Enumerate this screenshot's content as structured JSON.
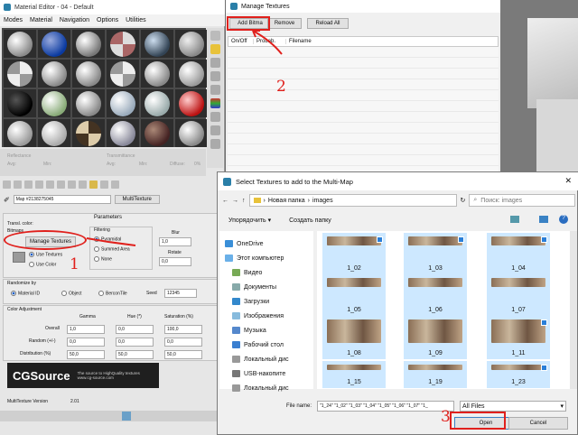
{
  "material_editor": {
    "title": "Material Editor - 04 - Default",
    "menu": [
      "Modes",
      "Material",
      "Navigation",
      "Options",
      "Utilities"
    ],
    "reflectance_label": "Reflectance",
    "transmittance_label": "Transmittance",
    "avg_label": "Avg:",
    "min_label": "Min:",
    "diffuse_label": "Diffuse:",
    "diffuse_value": "0%",
    "map_name": "Map #2138275045",
    "map_type": "MultiTexture",
    "parameters_title": "Parameters",
    "transl_color_label": "Transl. color:",
    "bitmaps_label": "Bitmaps",
    "manage_textures_btn": "Manage Textures",
    "filtering_label": "Filtering",
    "filter_options": [
      "Pyramidal",
      "Summed Area",
      "None"
    ],
    "blur_label": "Blur",
    "blur_value": "1,0",
    "rotate_label": "Rotate",
    "rotate_value": "0,0",
    "use_textures": "Use Textures",
    "use_color": "Use Color",
    "randomize_label": "Randomize by",
    "randomize_options": [
      "Material ID",
      "Object",
      "BerconTile"
    ],
    "seed_label": "Seed",
    "seed_value": "12345",
    "color_adjustment_label": "Color Adjustment",
    "col_headers": [
      "Gamma",
      "Hue (*)",
      "Saturation (%)"
    ],
    "rows": [
      {
        "label": "Overall",
        "values": [
          "1,0",
          "0,0",
          "100,0"
        ]
      },
      {
        "label": "Random (+/-)",
        "values": [
          "0,0",
          "0,0",
          "0,0"
        ]
      },
      {
        "label": "Distribution (%)",
        "values": [
          "50,0",
          "50,0",
          "50,0"
        ]
      }
    ],
    "logo_text": "CGSource",
    "logo_tagline": "The source to HighQuality textures www.cg-source.com",
    "version_label": "MultiTexture Version",
    "version_value": "2.01"
  },
  "manage_textures": {
    "title": "Manage Textures",
    "buttons": [
      "Add Bitma",
      "Remove",
      "Reload All"
    ],
    "columns": [
      "On/Off",
      "Probab.",
      "Filename"
    ]
  },
  "file_dialog": {
    "title": "Select Textures to add to the Multi-Map",
    "breadcrumb": [
      "Новая папка",
      "images"
    ],
    "search_placeholder": "Поиск: images",
    "organize": "Упорядочить",
    "new_folder": "Создать папку",
    "nav": [
      "OneDrive",
      "Этот компьютер",
      "Видео",
      "Документы",
      "Загрузки",
      "Изображения",
      "Музыка",
      "Рабочий стол",
      "Локальный дис",
      "USB-накопите",
      "Локальный дис"
    ],
    "files": [
      "1_02",
      "1_03",
      "1_04",
      "1_05",
      "1_06",
      "1_07",
      "1_08",
      "1_09",
      "1_11",
      "1_15",
      "1_19",
      "1_23"
    ],
    "filename_label": "File name:",
    "filename_value": "\"1_24\" \"1_02\" \"1_03\" \"1_04\" \"1_05\" \"1_06\" \"1_07\" \"1_",
    "filetype": "All Files",
    "open_btn": "Open",
    "cancel_btn": "Cancel"
  },
  "annotations": [
    "1",
    "2",
    "3"
  ]
}
